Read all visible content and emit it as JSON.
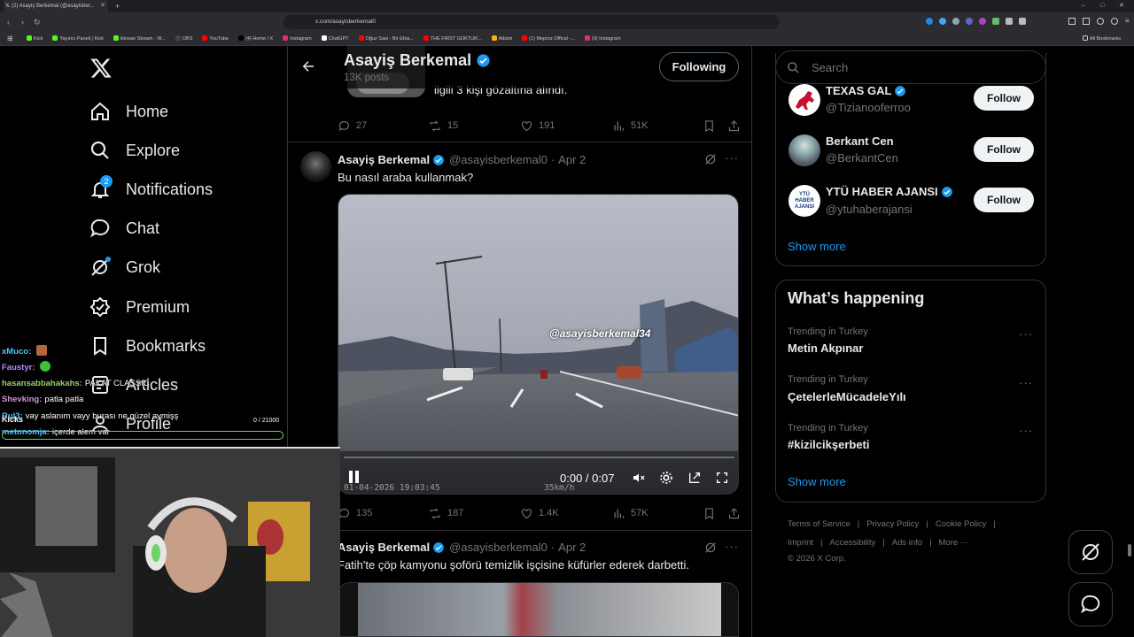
{
  "browser": {
    "tab_title": "(2) Asayiş Berkemal (@asayisber...",
    "url": "x.com/asayisberkemal0",
    "bookmarks": [
      {
        "label": "Kick",
        "color": "#53fc18"
      },
      {
        "label": "Yayıncı Paneli | Kick",
        "color": "#53fc18"
      },
      {
        "label": "ikinsan Stream - W...",
        "color": "#53fc18"
      },
      {
        "label": "OBS",
        "color": "#444"
      },
      {
        "label": "YouTube",
        "color": "#ff0000"
      },
      {
        "label": "(4) Home / X",
        "color": "#000"
      },
      {
        "label": "Instagram",
        "color": "#e1306c"
      },
      {
        "label": "ChatGPT",
        "color": "#fff"
      },
      {
        "label": "Oğuz Sasi - Bir Efsa...",
        "color": "#ff0000"
      },
      {
        "label": "THE FIRST GOKTUR...",
        "color": "#ff0000"
      },
      {
        "label": "Albüm",
        "color": "#ffb300"
      },
      {
        "label": "(1) Meproz Offical -...",
        "color": "#ff0000"
      },
      {
        "label": "(9) Instagram",
        "color": "#e1306c"
      }
    ],
    "all_bookmarks": "All Bookmarks"
  },
  "nav": {
    "items": [
      {
        "label": "Home",
        "icon": "home-icon"
      },
      {
        "label": "Explore",
        "icon": "search-icon"
      },
      {
        "label": "Notifications",
        "icon": "bell-icon",
        "badge": "2"
      },
      {
        "label": "Chat",
        "icon": "chat-icon"
      },
      {
        "label": "Grok",
        "icon": "grok-icon"
      },
      {
        "label": "Premium",
        "icon": "premium-icon"
      },
      {
        "label": "Bookmarks",
        "icon": "bookmark-icon"
      },
      {
        "label": "Articles",
        "icon": "articles-icon"
      },
      {
        "label": "Profile",
        "icon": "profile-icon"
      }
    ]
  },
  "profile_header": {
    "name": "Asayiş Berkemal",
    "posts": "13K posts",
    "follow_state": "Following"
  },
  "prev_tweet": {
    "text_fragment": "ilgili 3 kişi gözaltına alındı.",
    "replies": "27",
    "reposts": "15",
    "likes": "191",
    "views": "51K"
  },
  "tweet": {
    "name": "Asayiş Berkemal",
    "handle": "@asayisberkemal0",
    "date": "Apr 2",
    "text": "Bu nasıl araba kullanmak?",
    "video": {
      "watermark": "@asayisberkemal34",
      "time": "0:00 / 0:07",
      "timestamp": "01-04-2026 19:03:45",
      "speed": "35km/h",
      "progress": 0
    },
    "replies": "135",
    "reposts": "187",
    "likes": "1.4K",
    "views": "57K"
  },
  "next_tweet": {
    "name": "Asayiş Berkemal",
    "handle": "@asayisberkemal0",
    "date": "Apr 2",
    "text": "Fatih'te çöp kamyonu şoförü temizlik işçisine küfürler ederek darbetti."
  },
  "search": {
    "placeholder": "Search"
  },
  "who_to_follow": {
    "accounts": [
      {
        "name": "TEXAS GAL",
        "handle": "@Tizianooferroo",
        "verified": true,
        "button": "Follow"
      },
      {
        "name": "Berkant Cen",
        "handle": "@BerkantCen",
        "verified": false,
        "button": "Follow"
      },
      {
        "name": "YTÜ HABER AJANSI",
        "handle": "@ytuhaberajansi",
        "verified": true,
        "button": "Follow",
        "avatar_text": "YTÜ HABER AJANSI"
      }
    ],
    "show_more": "Show more"
  },
  "happening": {
    "title": "What’s happening",
    "trends": [
      {
        "context": "Trending in Turkey",
        "topic": "Metin Akpınar"
      },
      {
        "context": "Trending in Turkey",
        "topic": "ÇetelerleMücadeleYılı"
      },
      {
        "context": "Trending in Turkey",
        "topic": "#kizilcikşerbeti"
      }
    ],
    "show_more": "Show more"
  },
  "footer": {
    "links": [
      "Terms of Service",
      "Privacy Policy",
      "Cookie Policy",
      "Imprint",
      "Accessibility",
      "Ads info",
      "More ···"
    ],
    "copyright": "© 2026 X Corp."
  },
  "stream_overlay": {
    "chat": [
      {
        "user": "xMuco:",
        "color": "#4fc3f7",
        "msg": ""
      },
      {
        "user": "Faustyr:",
        "color": "#b388ff",
        "msg": ""
      },
      {
        "user": "hasansabbahakahs:",
        "color": "#9ccc65",
        "msg": "PAKAT CLASSIC"
      },
      {
        "user": "Shevking:",
        "color": "#ce93d8",
        "msg": "patla patla"
      },
      {
        "user": "Rul3:",
        "color": "#4fc3f7",
        "msg": "vay aslanım vayy burası ne güzel aymişş"
      },
      {
        "user": "metonomja:",
        "color": "#4fc3f7",
        "msg": "içerde alem var"
      }
    ],
    "goal_label": "Kicks",
    "goal_count": "0 / 21000"
  },
  "colors": {
    "accent": "#1d9bf0",
    "bg": "#000000",
    "border": "#2f3336"
  }
}
